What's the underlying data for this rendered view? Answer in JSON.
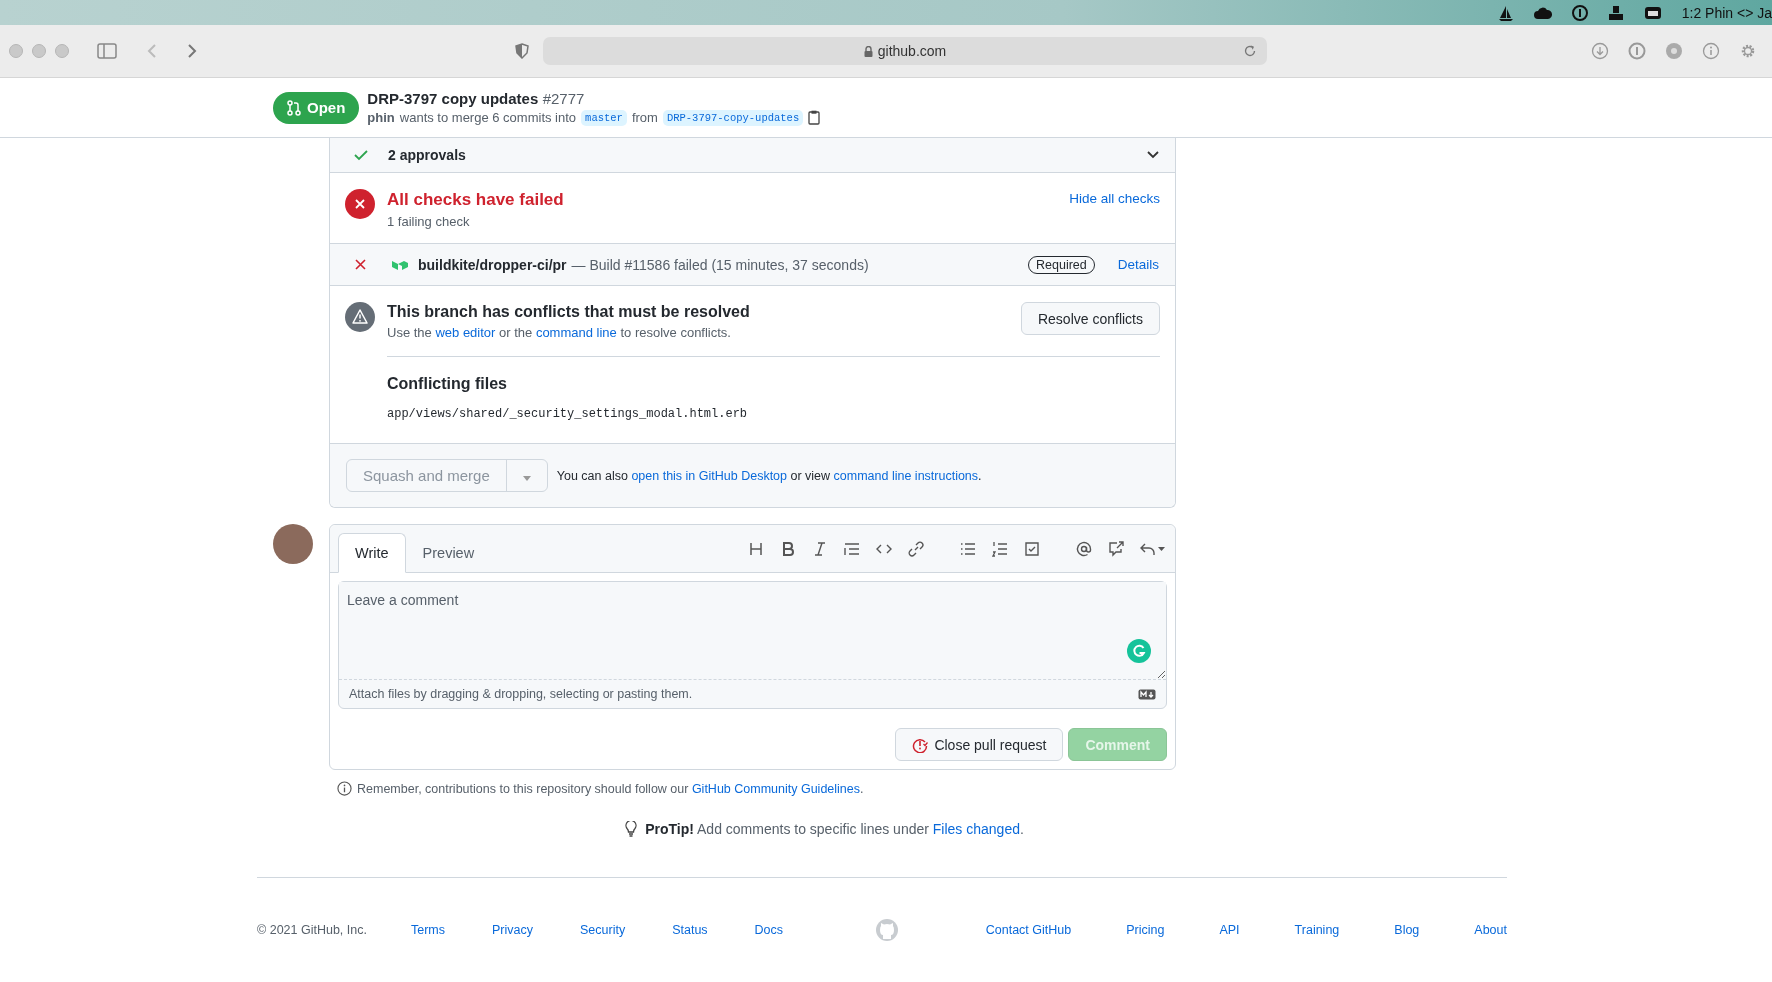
{
  "menu_bar": {
    "status_text": "1:2 Phin <> Ja"
  },
  "browser": {
    "url": "github.com"
  },
  "pr_header": {
    "state": "Open",
    "title": "DRP-3797 copy updates",
    "number": "#2777",
    "author": "phin",
    "summary": "wants to merge 6 commits into",
    "base_branch": "master",
    "from_word": "from",
    "head_branch": "DRP-3797-copy-updates"
  },
  "approvals": {
    "label": "2 approvals",
    "expanded": false
  },
  "checks": {
    "title": "All checks have failed",
    "subtitle": "1 failing check",
    "toggle_link": "Hide all checks",
    "items": [
      {
        "name": "buildkite/dropper-ci/pr",
        "description": "— Build #11586 failed (15 minutes, 37 seconds)",
        "badge": "Required",
        "link": "Details",
        "failed": true
      }
    ]
  },
  "conflicts": {
    "title": "This branch has conflicts that must be resolved",
    "message": {
      "before": "Use the",
      "link_1": "web editor",
      "middle": "or the",
      "link_2": "command line",
      "after": "to resolve conflicts."
    },
    "button": "Resolve conflicts",
    "files_title": "Conflicting files",
    "files": [
      "app/views/shared/_security_settings_modal.html.erb"
    ]
  },
  "merge": {
    "button": "Squash and merge",
    "disabled": true,
    "note": {
      "before": "You can also",
      "link_1": "open this in GitHub Desktop",
      "middle": "or view",
      "link_2": "command line instructions",
      "after": "."
    }
  },
  "comment": {
    "tabs": [
      {
        "label": "Write",
        "selected": true
      },
      {
        "label": "Preview",
        "selected": false
      }
    ],
    "placeholder": "Leave a comment",
    "attach_hint": "Attach files by dragging & dropping, selecting or pasting them.",
    "close_button": "Close pull request",
    "submit_button": "Comment",
    "submit_disabled": true
  },
  "guidelines": {
    "text": "Remember, contributions to this repository should follow our",
    "link": "GitHub Community Guidelines",
    "after": "."
  },
  "protip": {
    "label": "ProTip!",
    "text": "Add comments to specific lines under",
    "link": "Files changed",
    "after": "."
  },
  "footer": {
    "copyright": "© 2021 GitHub, Inc.",
    "left_links": [
      "Terms",
      "Privacy",
      "Security",
      "Status",
      "Docs"
    ],
    "right_links": [
      "Contact GitHub",
      "Pricing",
      "API",
      "Training",
      "Blog",
      "About"
    ]
  }
}
